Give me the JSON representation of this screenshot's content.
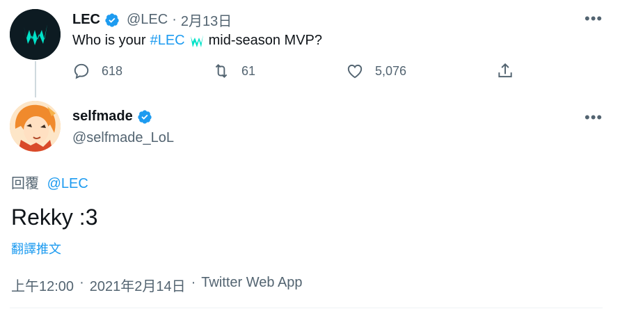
{
  "parent_tweet": {
    "name": "LEC",
    "handle": "@LEC",
    "separator": "·",
    "date": "2月13日",
    "text_before": "Who is your",
    "hashtag": "#LEC",
    "text_after": "mid-season MVP?",
    "more_icon": "more-horizontal-icon",
    "actions": {
      "reply_count": "618",
      "retweet_count": "61",
      "like_count": "5,076"
    }
  },
  "reply_tweet": {
    "name": "selfmade",
    "handle": "@selfmade_LoL",
    "replying_label": "回覆",
    "replying_to": "@LEC",
    "text": "Rekky :3",
    "translate_label": "翻譯推文",
    "time": "上午12:00",
    "separator": "·",
    "date": "2021年2月14日",
    "source": "Twitter Web App",
    "more_icon": "more-horizontal-icon"
  },
  "colors": {
    "accent": "#1d9bf0",
    "muted": "#536471",
    "lec_brand": "#00e2c8"
  }
}
